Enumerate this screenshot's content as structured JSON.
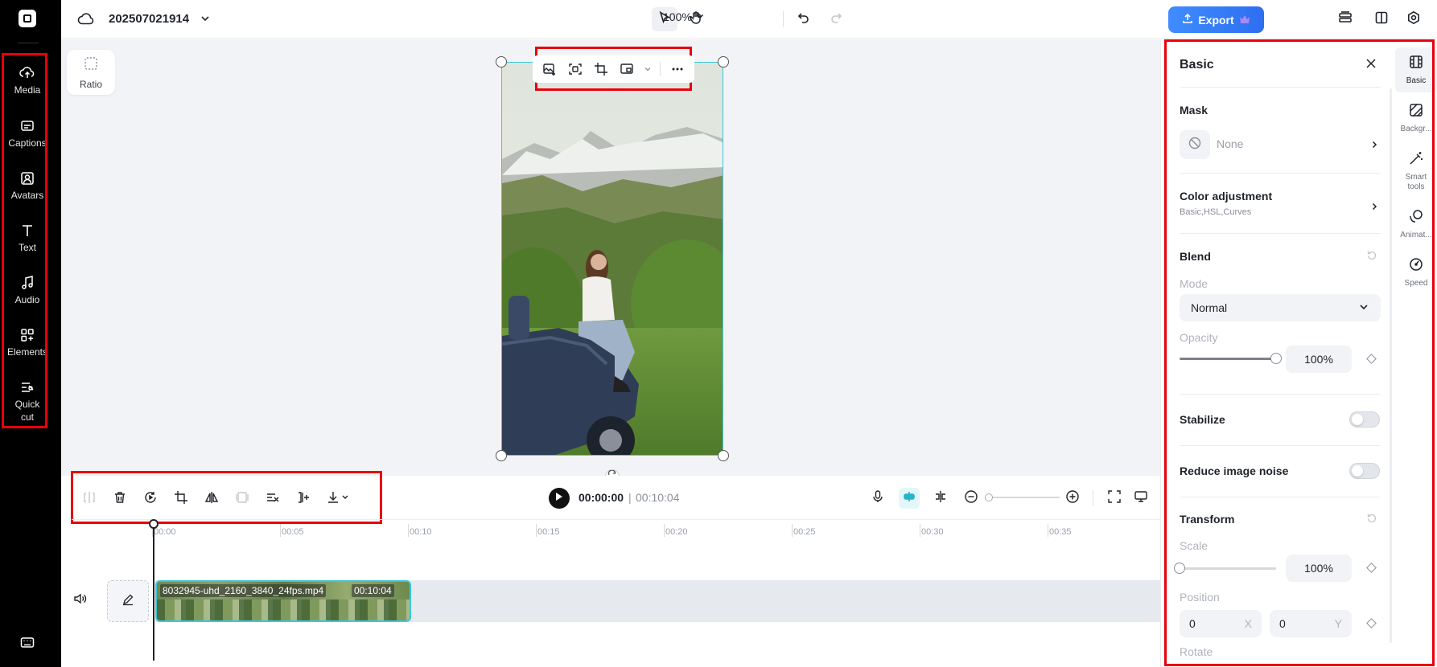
{
  "project": {
    "title": "202507021914"
  },
  "sidebar": {
    "items": [
      {
        "label": "Media",
        "icon": "cloud-upload-icon"
      },
      {
        "label": "Captions",
        "icon": "captions-icon"
      },
      {
        "label": "Avatars",
        "icon": "avatar-icon"
      },
      {
        "label": "Text",
        "icon": "text-icon"
      },
      {
        "label": "Audio",
        "icon": "music-note-icon"
      },
      {
        "label": "Elements",
        "icon": "elements-icon"
      },
      {
        "label": "Quick cut",
        "icon": "quick-cut-icon"
      }
    ]
  },
  "topbar": {
    "zoom": "100%",
    "export_label": "Export"
  },
  "canvas": {
    "ratio_label": "Ratio"
  },
  "timeline": {
    "current_time": "00:00:00",
    "separator": "|",
    "total_time": "00:10:04",
    "ticks": [
      "00:00",
      "00:05",
      "00:10",
      "00:15",
      "00:20",
      "00:25",
      "00:30",
      "00:35"
    ],
    "clip": {
      "name": "8032945-uhd_2160_3840_24fps.mp4",
      "duration": "00:10:04"
    }
  },
  "panel": {
    "title": "Basic",
    "mask": {
      "title": "Mask",
      "value": "None"
    },
    "color_adjustment": {
      "title": "Color adjustment",
      "subtitle": "Basic,HSL,Curves"
    },
    "blend": {
      "title": "Blend",
      "mode_label": "Mode",
      "mode_value": "Normal",
      "opacity_label": "Opacity",
      "opacity_value": "100%",
      "opacity_fraction": 1.0
    },
    "stabilize": {
      "title": "Stabilize",
      "enabled": false
    },
    "reduce_noise": {
      "title": "Reduce image noise",
      "enabled": false
    },
    "transform": {
      "title": "Transform",
      "scale_label": "Scale",
      "scale_value": "100%",
      "scale_fraction": 0.0,
      "position_label": "Position",
      "pos_x": "0",
      "pos_x_axis": "X",
      "pos_y": "0",
      "pos_y_axis": "Y",
      "rotate_label": "Rotate"
    }
  },
  "right_tabs": [
    {
      "label": "Basic",
      "icon": "film-icon"
    },
    {
      "label": "Backgr...",
      "icon": "background-icon"
    },
    {
      "label": "Smart tools",
      "icon": "magic-wand-icon"
    },
    {
      "label": "Animat...",
      "icon": "animation-icon"
    },
    {
      "label": "Speed",
      "icon": "speed-icon"
    }
  ],
  "colors": {
    "accent": "#2d6ff0",
    "selection": "#3bc7d9",
    "highlight_box": "#e8000b"
  }
}
